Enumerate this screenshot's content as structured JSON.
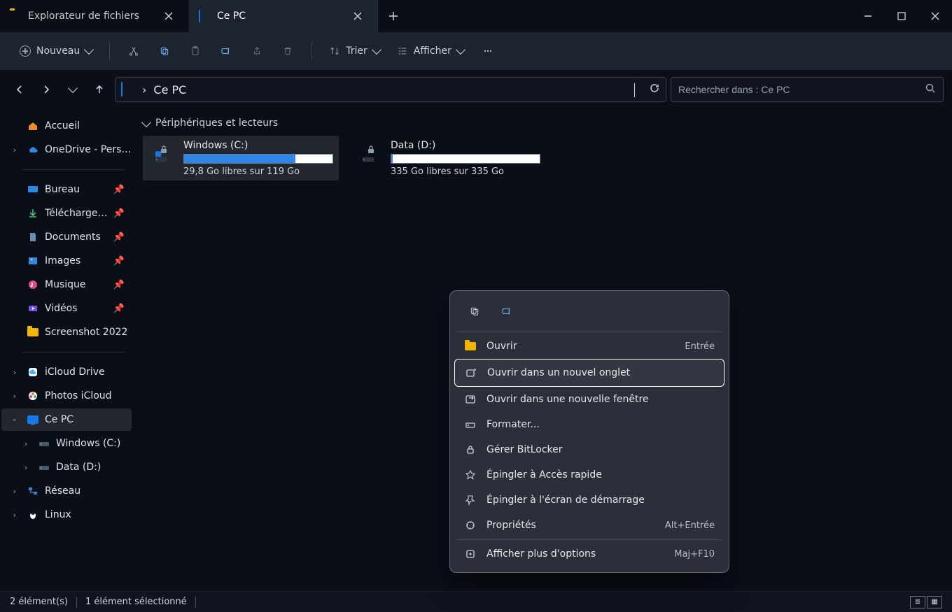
{
  "tabs": {
    "t0": {
      "label": "Explorateur de fichiers"
    },
    "t1": {
      "label": "Ce PC"
    }
  },
  "toolbar": {
    "new": "Nouveau",
    "sort": "Trier",
    "view": "Afficher"
  },
  "address": {
    "breadcrumb_sep": "›",
    "location": "Ce PC"
  },
  "search": {
    "placeholder": "Rechercher dans : Ce PC"
  },
  "sidebar": {
    "home": "Accueil",
    "onedrive": "OneDrive - Persona",
    "desktop": "Bureau",
    "downloads": "Téléchargements",
    "documents": "Documents",
    "images": "Images",
    "music": "Musique",
    "videos": "Vidéos",
    "screenshot": "Screenshot 2022",
    "icloud_drive": "iCloud Drive",
    "photos_icloud": "Photos iCloud",
    "this_pc": "Ce PC",
    "windows_c": "Windows (C:)",
    "data_d": "Data (D:)",
    "network": "Réseau",
    "linux": "Linux"
  },
  "content": {
    "group_header": "Périphériques et lecteurs",
    "drives": {
      "c": {
        "name": "Windows (C:)",
        "fill_pct": 75,
        "subtitle": "29,8 Go libres sur 119 Go"
      },
      "d": {
        "name": "Data (D:)",
        "fill_pct": 1,
        "subtitle": "335 Go libres sur 335 Go"
      }
    }
  },
  "context_menu": {
    "open": {
      "label": "Ouvrir",
      "shortcut": "Entrée"
    },
    "open_new_tab": {
      "label": "Ouvrir dans un nouvel onglet",
      "shortcut": ""
    },
    "open_new_win": {
      "label": "Ouvrir dans une nouvelle fenêtre",
      "shortcut": ""
    },
    "format": {
      "label": "Formater...",
      "shortcut": ""
    },
    "bitlocker": {
      "label": "Gérer BitLocker",
      "shortcut": ""
    },
    "pin_quick": {
      "label": "Épingler à Accès rapide",
      "shortcut": ""
    },
    "pin_start": {
      "label": "Épingler à l'écran de démarrage",
      "shortcut": ""
    },
    "properties": {
      "label": "Propriétés",
      "shortcut": "Alt+Entrée"
    },
    "show_more": {
      "label": "Afficher plus d'options",
      "shortcut": "Maj+F10"
    }
  },
  "status": {
    "count": "2 élément(s)",
    "selection": "1 élément sélectionné"
  }
}
